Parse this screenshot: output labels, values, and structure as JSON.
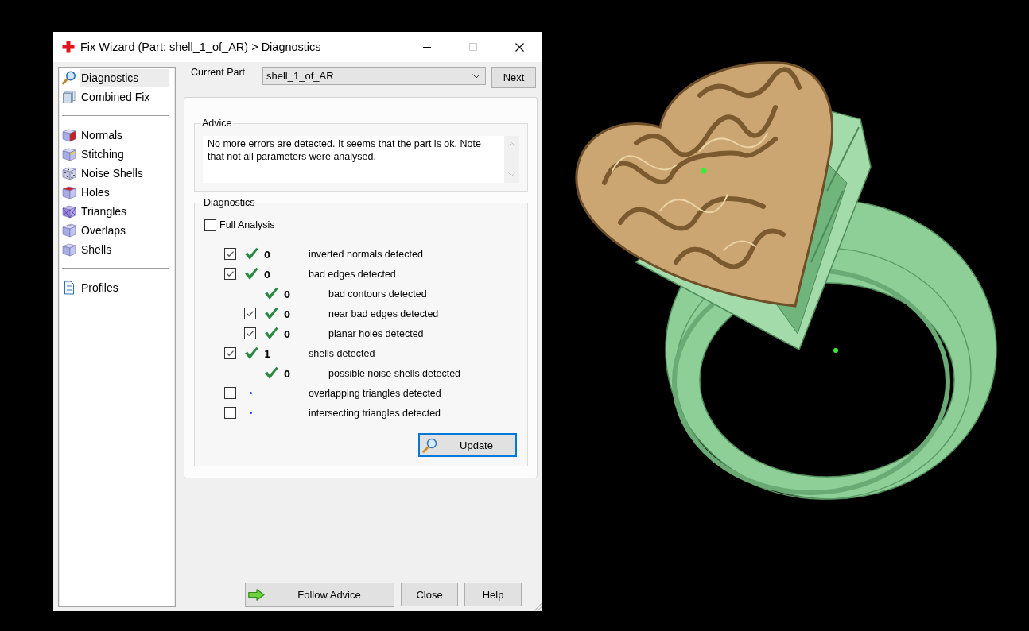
{
  "window": {
    "title": "Fix Wizard (Part: shell_1_of_AR) > Diagnostics",
    "maximize_disabled": true
  },
  "sidebar": {
    "sections": [
      {
        "items": [
          {
            "label": "Diagnostics",
            "selected": true
          },
          {
            "label": "Combined Fix",
            "selected": false
          }
        ]
      },
      {
        "items": [
          {
            "label": "Normals",
            "selected": false
          },
          {
            "label": "Stitching",
            "selected": false
          },
          {
            "label": "Noise Shells",
            "selected": false
          },
          {
            "label": "Holes",
            "selected": false
          },
          {
            "label": "Triangles",
            "selected": false
          },
          {
            "label": "Overlaps",
            "selected": false
          },
          {
            "label": "Shells",
            "selected": false
          }
        ]
      },
      {
        "items": [
          {
            "label": "Profiles",
            "selected": false
          }
        ]
      }
    ]
  },
  "current_part": {
    "label": "Current Part",
    "value": "shell_1_of_AR"
  },
  "next_button": "Next",
  "advice": {
    "title": "Advice",
    "text": "No more errors are detected. It seems that the part is ok. Note that not all parameters were analysed."
  },
  "diagnostics": {
    "title": "Diagnostics",
    "full_analysis": {
      "label": "Full Analysis",
      "checked": false
    },
    "rows": [
      {
        "kind": "checkbox",
        "checked": true,
        "analysed": true,
        "count": "0",
        "label": "inverted normals detected"
      },
      {
        "kind": "checkbox",
        "checked": true,
        "analysed": true,
        "count": "0",
        "label": "bad edges detected",
        "children": [
          {
            "kind": "plain",
            "analysed": true,
            "count": "0",
            "label": "bad contours detected"
          },
          {
            "kind": "checkbox",
            "checked": true,
            "analysed": true,
            "count": "0",
            "label": "near bad edges detected"
          },
          {
            "kind": "checkbox",
            "checked": true,
            "analysed": true,
            "count": "0",
            "label": "planar holes detected"
          }
        ]
      },
      {
        "kind": "checkbox",
        "checked": true,
        "analysed": true,
        "count": "1",
        "label": "shells detected",
        "children": [
          {
            "kind": "plain",
            "analysed": true,
            "count": "0",
            "label": "possible noise shells detected"
          }
        ]
      },
      {
        "kind": "checkbox",
        "checked": false,
        "analysed": false,
        "label": "overlapping triangles detected"
      },
      {
        "kind": "checkbox",
        "checked": false,
        "analysed": false,
        "label": "intersecting triangles detected"
      }
    ],
    "update_button": {
      "label": "Update",
      "focused": true
    }
  },
  "footer": {
    "follow_advice": "Follow Advice",
    "close": "Close",
    "help": "Help"
  }
}
